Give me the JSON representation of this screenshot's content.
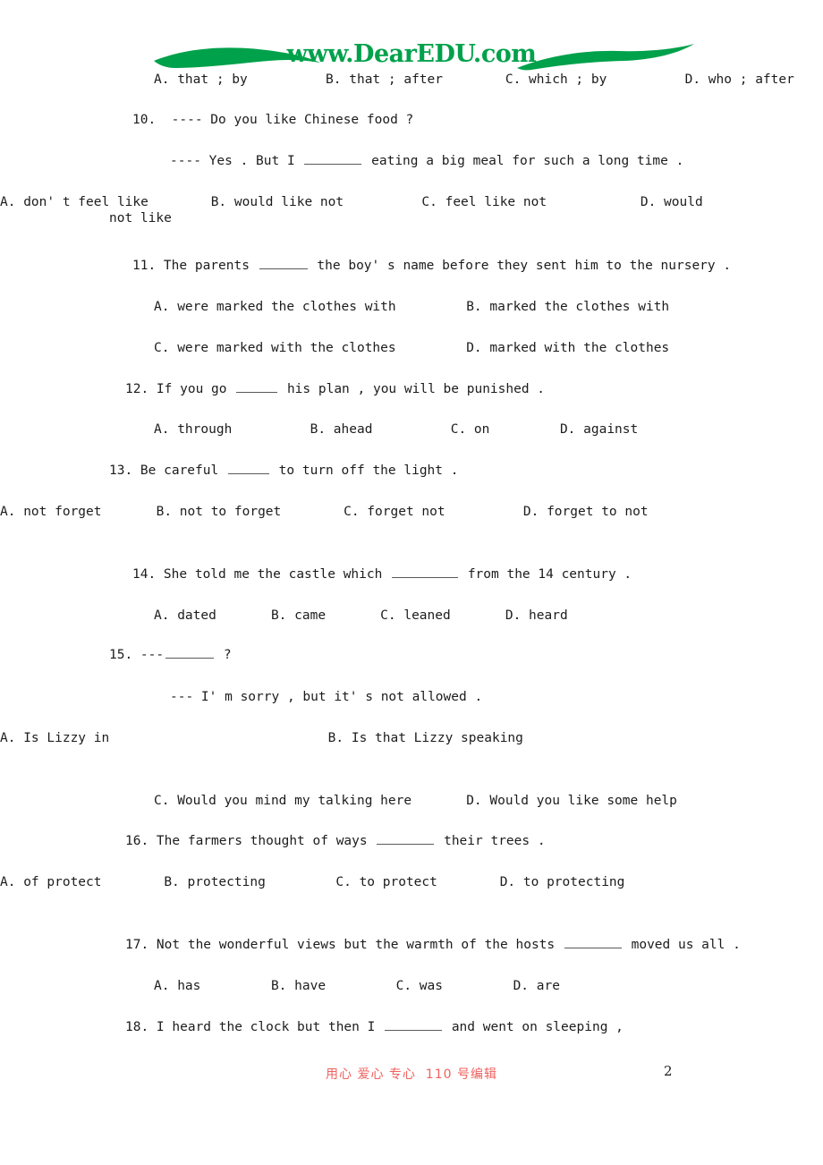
{
  "header": {
    "logo_text": "www.DearEDU.com",
    "logo_color": "#00a14b",
    "left_wave_icon": "green-wave-swoosh",
    "right_wave_icon": "green-wave-swoosh"
  },
  "lines": {
    "q09_options": "A. that ; by          B. that ; after        C. which ; by          D. who ; after",
    "q10_stem": "10.  ---- Do you like Chinese food ?",
    "q10_reply_a": "---- Yes . But I ",
    "q10_reply_b": " eating a big meal for such a long time .",
    "q10_options": "A. don' t feel like        B. would like not          C. feel like not            D. would not like",
    "q11_stem_a": "11. The parents ",
    "q11_stem_b": " the boy' s name before they sent him to the nursery .",
    "q11_opt_ab": "A. were marked the clothes with         B. marked the clothes with",
    "q11_opt_cd": "C. were marked with the clothes         D. marked with the clothes",
    "q12_stem_a": "12. If you go ",
    "q12_stem_b": " his plan , you will be punished .",
    "q12_options": "A. through          B. ahead          C. on         D. against",
    "q13_stem_a": "13. Be careful ",
    "q13_stem_b": " to turn off the light .",
    "q13_options": "A. not forget       B. not to forget        C. forget not          D. forget to not",
    "q14_stem_a": "14. She told me the castle which ",
    "q14_stem_b": " from the 14 century .",
    "q14_options": "A. dated       B. came       C. leaned       D. heard",
    "q15_stem_a": "15. ---",
    "q15_stem_b": " ?",
    "q15_reply": "--- I' m sorry , but it' s not allowed .",
    "q15_opt_ab": "A. Is Lizzy in                            B. Is that Lizzy speaking",
    "q15_opt_cd": "C. Would you mind my talking here       D. Would you like some help",
    "q16_stem_a": "16. The farmers thought of ways ",
    "q16_stem_b": " their trees .",
    "q16_options": "A. of protect        B. protecting         C. to protect        D. to protecting",
    "q17_stem_a": "17. Not the wonderful views but the warmth of the hosts ",
    "q17_stem_b": " moved us all .",
    "q17_options": "A. has         B. have         C. was         D. are",
    "q18_stem_a": "18. I heard the clock but then I ",
    "q18_stem_b": " and went on sleeping ,"
  },
  "footer": {
    "note": "用心 爱心 专心  110 号编辑",
    "note_color": "#f0615e",
    "page_number": "2"
  }
}
